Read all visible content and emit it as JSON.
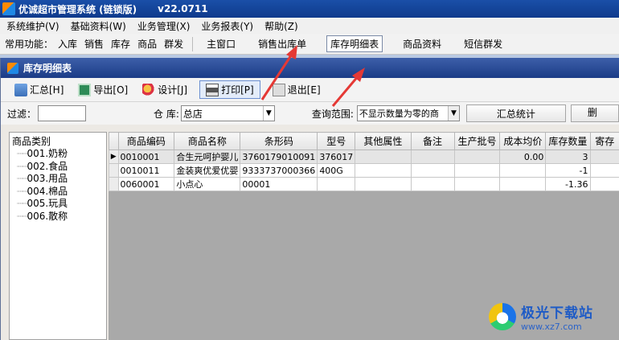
{
  "window": {
    "title": "优诚超市管理系统 (链锁版)",
    "version": "v22.0711"
  },
  "menu": [
    "系统维护(V)",
    "基础资料(W)",
    "业务管理(X)",
    "业务报表(Y)",
    "帮助(Z)"
  ],
  "quickbar": {
    "label": "常用功能：",
    "items": [
      "入库",
      "销售",
      "库存",
      "商品",
      "群发"
    ],
    "tabs": [
      "主窗口",
      "销售出库单",
      "库存明细表",
      "商品资料",
      "短信群发"
    ],
    "active_tab": "库存明细表"
  },
  "child_window": {
    "title": "库存明细表"
  },
  "toolbar": {
    "buttons": [
      {
        "label": "汇总[H]",
        "icon": "summary-icon"
      },
      {
        "label": "导出[O]",
        "icon": "export-icon"
      },
      {
        "label": "设计[J]",
        "icon": "design-icon"
      },
      {
        "label": "打印[P]",
        "icon": "printer-icon"
      },
      {
        "label": "退出[E]",
        "icon": "exit-icon"
      }
    ]
  },
  "filter": {
    "filter_label": "过滤：",
    "filter_value": "",
    "store_label": "仓 库:",
    "store_value": "总店",
    "range_label": "查询范围:",
    "range_value": "不显示数量为零的商",
    "summary_button": "汇总统计",
    "cut_button": "删"
  },
  "tree": {
    "root": "商品类别",
    "nodes": [
      "001.奶粉",
      "002.食品",
      "003.用品",
      "004.棉品",
      "005.玩具",
      "006.散称"
    ]
  },
  "grid": {
    "columns": [
      "商品编码",
      "商品名称",
      "条形码",
      "型号",
      "其他属性",
      "备注",
      "生产批号",
      "成本均价",
      "库存数量",
      "寄存"
    ],
    "rows": [
      {
        "code": "0010001",
        "name": "合生元呵护婴儿",
        "barcode": "3760179010091",
        "model": "376017",
        "attr": "",
        "remark": "",
        "batch": "",
        "cost": "0.00",
        "qty": "3",
        "consign": ""
      },
      {
        "code": "0010011",
        "name": "金装爽优爱优婴",
        "barcode": "9333737000366",
        "model": "400G",
        "attr": "",
        "remark": "",
        "batch": "",
        "cost": "",
        "qty": "-1",
        "consign": ""
      },
      {
        "code": "0060001",
        "name": "小点心",
        "barcode": "00001",
        "model": "",
        "attr": "",
        "remark": "",
        "batch": "",
        "cost": "",
        "qty": "-1.36",
        "consign": ""
      }
    ]
  },
  "watermark": {
    "main": "极光下载站",
    "sub": "www.xz7.com"
  },
  "colors": {
    "title_bar": "#1a4fa8",
    "child_title_bar": "#2b4d99",
    "annotation_arrow": "#e53935"
  }
}
